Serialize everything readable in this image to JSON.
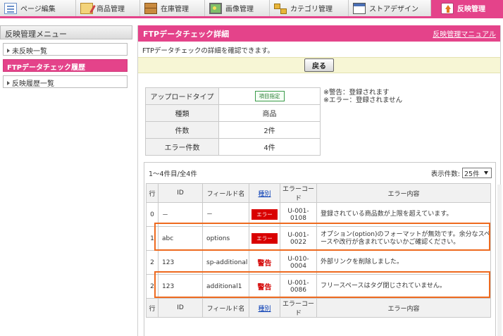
{
  "nav": {
    "tabs": [
      {
        "label": "ページ編集",
        "icon": "page-edit-icon"
      },
      {
        "label": "商品管理",
        "icon": "product-icon"
      },
      {
        "label": "在庫管理",
        "icon": "inventory-icon"
      },
      {
        "label": "画像管理",
        "icon": "image-icon"
      },
      {
        "label": "カテゴリ管理",
        "icon": "category-icon"
      },
      {
        "label": "ストアデザイン",
        "icon": "store-design-icon"
      },
      {
        "label": "反映管理",
        "icon": "reflect-icon"
      }
    ],
    "active_index": 6
  },
  "sidebar": {
    "title": "反映管理メニュー",
    "items": [
      {
        "label": "未反映一覧",
        "active": false
      },
      {
        "label": "FTPデータチェック履歴",
        "active": true
      },
      {
        "label": "反映履歴一覧",
        "active": false
      }
    ]
  },
  "main": {
    "title": "FTPデータチェック詳細",
    "manual_link": "反映管理マニュアル",
    "description": "FTPデータチェックの詳細を確認できます。",
    "back_label": "戻る"
  },
  "info": {
    "rows": [
      {
        "key": "アップロードタイプ",
        "value": "項目指定"
      },
      {
        "key": "種類",
        "value": "商品"
      },
      {
        "key": "件数",
        "value": "2件"
      },
      {
        "key": "エラー件数",
        "value": "4件"
      }
    ],
    "notes": [
      "※警告：登録されます",
      "※エラー：登録されません"
    ]
  },
  "list": {
    "count_text": "1〜4件目/全4件",
    "per_page_label": "表示件数:",
    "per_page_value": "25件",
    "headers": {
      "row": "行",
      "id": "ID",
      "field": "フィールド名",
      "kind": "種別",
      "code": "エラーコード",
      "message": "エラー内容"
    },
    "rows": [
      {
        "row": "0",
        "id": "－",
        "field": "－",
        "kind": "エラー",
        "kind_type": "error",
        "code": "U-001-0108",
        "message": "登録されている商品数が上限を超えています。"
      },
      {
        "row": "1",
        "id": "abc",
        "field": "options",
        "kind": "エラー",
        "kind_type": "error",
        "code": "U-001-0022",
        "message": "オプション(option)のフォーマットが無効です。余分なスペースや改行が含まれていないかご確認ください。"
      },
      {
        "row": "2",
        "id": "123",
        "field": "sp-additional",
        "kind": "警告",
        "kind_type": "warning",
        "code": "U-010-0004",
        "message": "外部リンクを削除しました。"
      },
      {
        "row": "2",
        "id": "123",
        "field": "additional1",
        "kind": "警告",
        "kind_type": "warning",
        "code": "U-001-0086",
        "message": "フリースペースはタグ閉じされていません。"
      }
    ],
    "highlighted_rows": [
      1,
      3
    ],
    "highlight_color": "#ee6a1f"
  },
  "colors": {
    "accent": "#e4438a",
    "error": "#d90000",
    "link": "#0a3fb5"
  }
}
